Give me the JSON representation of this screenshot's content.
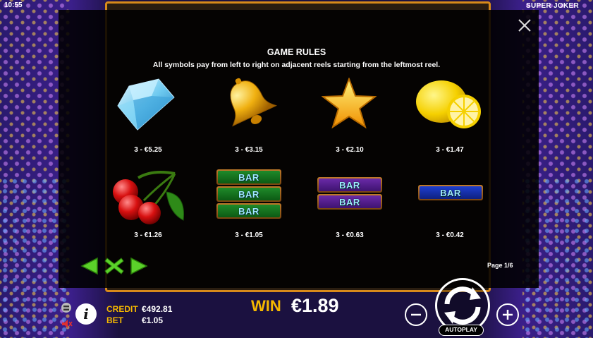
{
  "status": {
    "time": "10:55",
    "game_title": "SUPER JOKER"
  },
  "rules": {
    "title": "GAME RULES",
    "subtitle": "All symbols pay from left to right on adjacent reels starting from the leftmost reel.",
    "page": "Page 1/6"
  },
  "paytable": [
    {
      "symbol": "diamond-icon",
      "pay": "3 - €5.25"
    },
    {
      "symbol": "bell-icon",
      "pay": "3 - €3.15"
    },
    {
      "symbol": "star-icon",
      "pay": "3 - €2.10"
    },
    {
      "symbol": "lemon-icon",
      "pay": "3 - €1.47"
    },
    {
      "symbol": "cherries-icon",
      "pay": "3 - €1.26"
    },
    {
      "symbol": "triple-bar-icon",
      "pay": "3 - €1.05"
    },
    {
      "symbol": "double-bar-icon",
      "pay": "3 - €0.63"
    },
    {
      "symbol": "single-bar-icon",
      "pay": "3 - €0.42"
    }
  ],
  "bar_text": "BAR",
  "footer": {
    "credit_label": "CREDIT",
    "credit_value": "€492.81",
    "bet_label": "BET",
    "bet_value": "€1.05",
    "win_label": "WIN",
    "win_value": "€1.89",
    "info_label": "i",
    "autoplay_label": "AUTOPLAY"
  },
  "colors": {
    "accent_gold": "#f5b800",
    "nav_green": "#5bd12a",
    "frame_orange": "#d88a1a"
  }
}
